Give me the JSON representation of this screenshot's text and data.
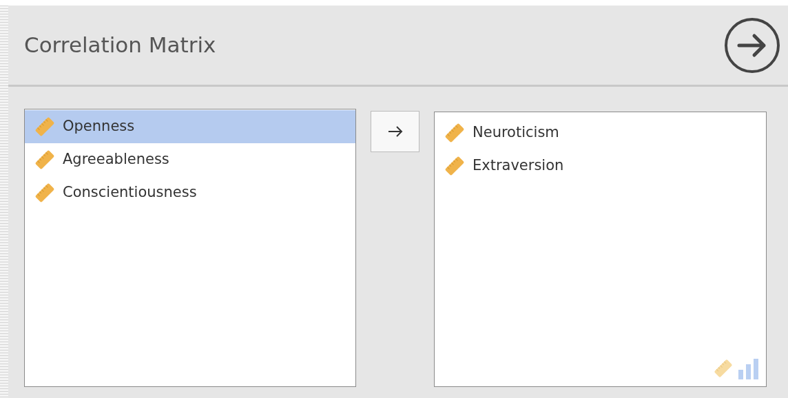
{
  "title": "Correlation Matrix",
  "available_variables": [
    {
      "name": "Openness",
      "selected": true
    },
    {
      "name": "Agreeableness",
      "selected": false
    },
    {
      "name": "Conscientiousness",
      "selected": false
    }
  ],
  "selected_variables": [
    {
      "name": "Neuroticism",
      "selected": false
    },
    {
      "name": "Extraversion",
      "selected": false
    }
  ]
}
